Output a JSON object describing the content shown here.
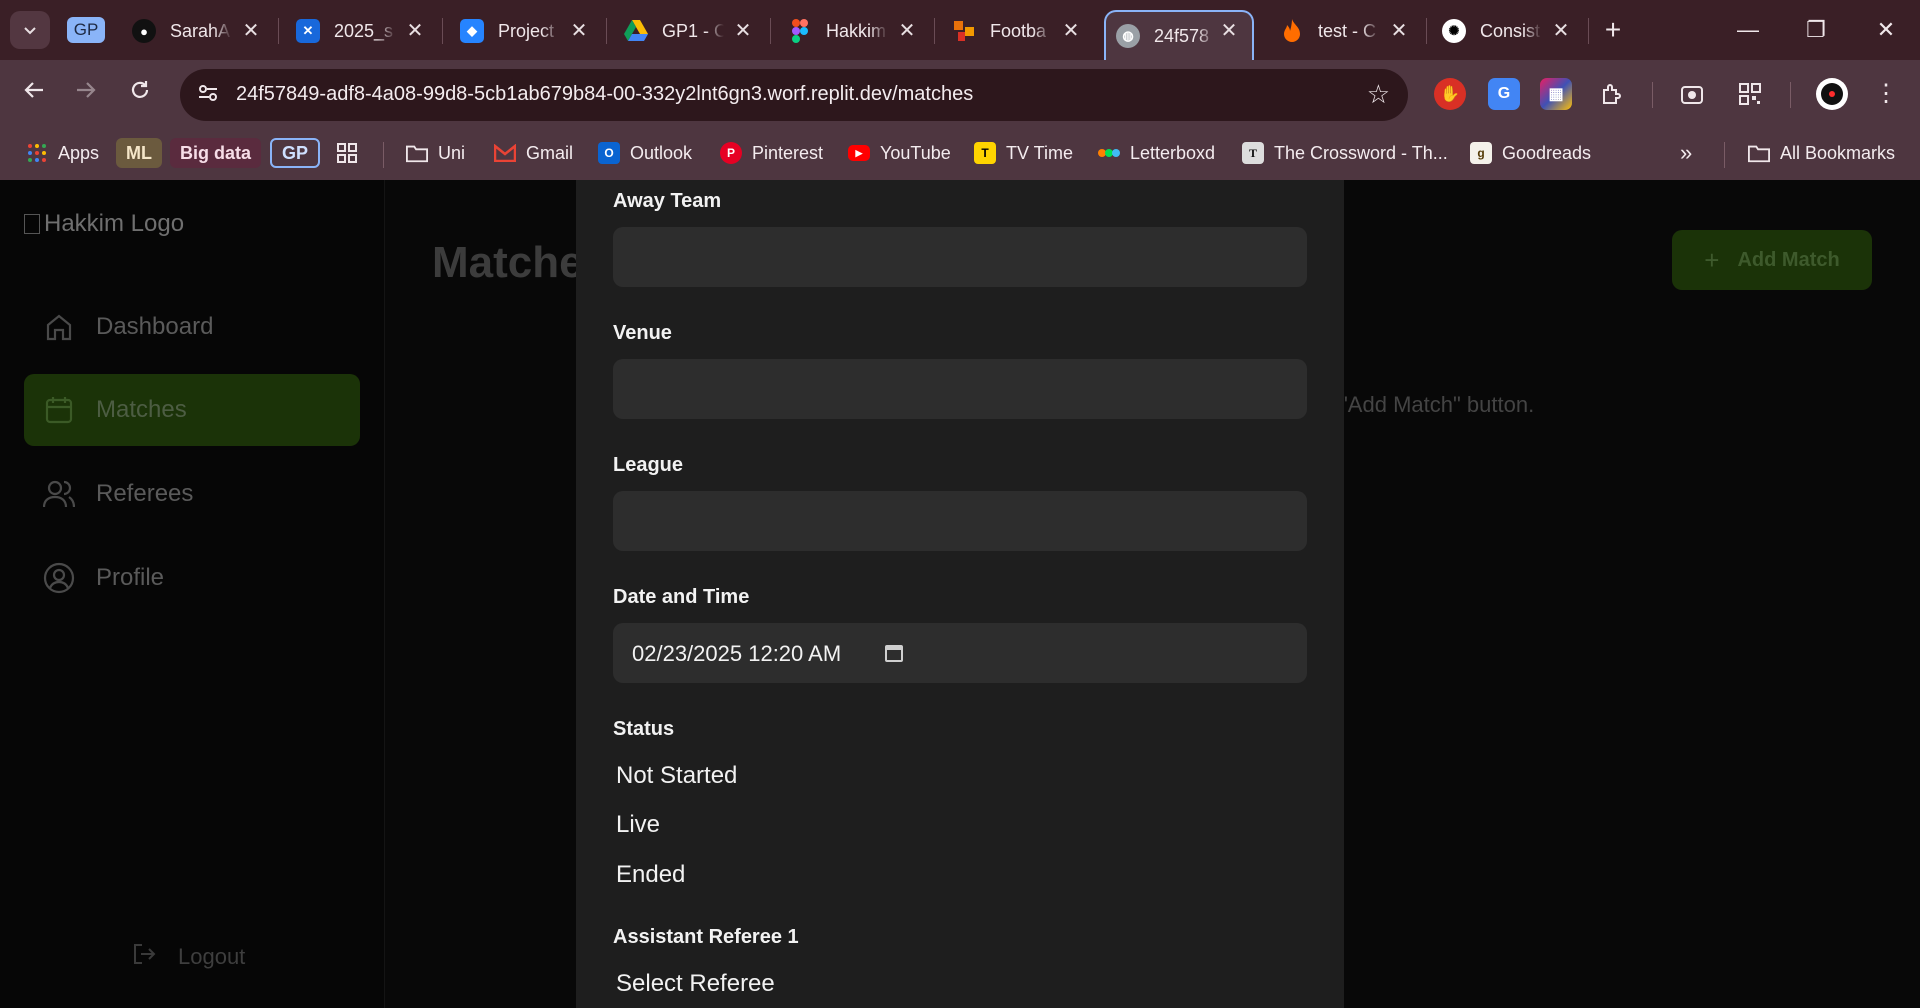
{
  "browser": {
    "tab_group_label": "GP",
    "tabs": [
      {
        "title": "SarahA",
        "icon": "github-icon"
      },
      {
        "title": "2025_s",
        "icon": "confluence-icon"
      },
      {
        "title": "Project",
        "icon": "jira-icon"
      },
      {
        "title": "GP1 - C",
        "icon": "google-drive-icon"
      },
      {
        "title": "Hakkim",
        "icon": "figma-icon"
      },
      {
        "title": "Footba",
        "icon": "app-icon"
      },
      {
        "title": "24f578",
        "icon": "globe-icon",
        "active": true
      },
      {
        "title": "test - C",
        "icon": "fire-icon"
      },
      {
        "title": "Consist",
        "icon": "chatgpt-icon"
      }
    ],
    "url": "24f57849-adf8-4a08-99d8-5cb1ab679b84-00-332y2lnt6gn3.worf.replit.dev/matches",
    "bookmarks": {
      "apps": "Apps",
      "ml": "ML",
      "big_data": "Big data",
      "gp": "GP",
      "uni": "Uni",
      "gmail": "Gmail",
      "outlook": "Outlook",
      "pinterest": "Pinterest",
      "youtube": "YouTube",
      "tvtime": "TV Time",
      "letterboxd": "Letterboxd",
      "crossword": "The Crossword - Th...",
      "goodreads": "Goodreads",
      "more": "»",
      "all": "All Bookmarks"
    }
  },
  "app": {
    "logo_alt": "Hakkim Logo",
    "nav": [
      {
        "label": "Dashboard"
      },
      {
        "label": "Matches",
        "active": true
      },
      {
        "label": "Referees"
      },
      {
        "label": "Profile"
      }
    ],
    "logout_label": "Logout",
    "page_title": "Matche",
    "add_match_label": "Add Match",
    "add_match_plus": "+",
    "empty_message": "\"Add Match\" button."
  },
  "form": {
    "away_team": {
      "label": "Away Team",
      "value": ""
    },
    "venue": {
      "label": "Venue",
      "value": ""
    },
    "league": {
      "label": "League",
      "value": ""
    },
    "datetime": {
      "label": "Date and Time",
      "value": "02/23/2025  12:20  AM"
    },
    "status": {
      "label": "Status",
      "options": [
        "Not Started",
        "Live",
        "Ended"
      ]
    },
    "assistant_referee_1": {
      "label": "Assistant Referee 1",
      "value": "Select Referee"
    }
  },
  "colors": {
    "chrome_dark": "#3a1f26",
    "chrome": "#4e3640",
    "active_nav": "#1b3308",
    "modal_bg": "#1e1e1e",
    "input_bg": "#2d2d2d"
  }
}
